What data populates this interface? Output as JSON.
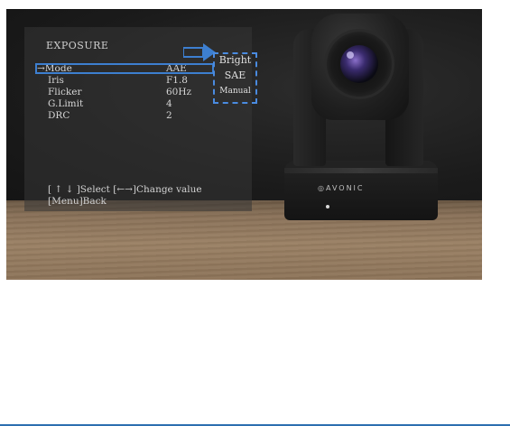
{
  "osd": {
    "title": "EXPOSURE",
    "rows": [
      {
        "label": "→Mode",
        "value": "AAE"
      },
      {
        "label": "Iris",
        "value": "F1.8"
      },
      {
        "label": "Flicker",
        "value": "60Hz"
      },
      {
        "label": "G.Limit",
        "value": "4"
      },
      {
        "label": "DRC",
        "value": "2"
      }
    ],
    "help": [
      "[ ↑ ↓ ]Select [←→]Change value",
      "[Menu]Back"
    ]
  },
  "mode_options": [
    "Bright",
    "SAE",
    "Manual"
  ],
  "camera": {
    "brand": "AVONIC"
  },
  "colors": {
    "highlight": "#3d7fd0",
    "osd_text": "#d6d6d6",
    "rule": "#2c6fb0"
  }
}
